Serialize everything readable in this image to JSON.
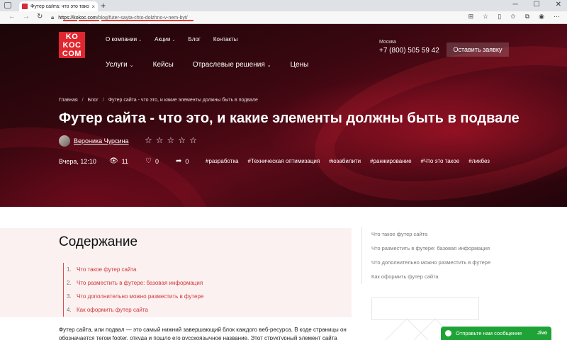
{
  "browser": {
    "tab_title": "Футер сайта: что это такое, ка",
    "tab_close": "×",
    "new_tab": "+",
    "url_host": "https://kokoc.com",
    "url_path": "/blog/futer-sayta-chto-dolzhno-v-nem-byt/"
  },
  "annotations": {
    "markers": [
      "1",
      "2",
      "3"
    ],
    "color": "#e53935"
  },
  "header": {
    "logo_lines": [
      "KO",
      "KOC",
      "COM"
    ],
    "top_nav": [
      {
        "label": "О компании",
        "has_dropdown": true
      },
      {
        "label": "Акции",
        "has_dropdown": true
      },
      {
        "label": "Блог",
        "has_dropdown": false
      },
      {
        "label": "Контакты",
        "has_dropdown": false
      }
    ],
    "main_nav": [
      {
        "label": "Услуги",
        "has_dropdown": true
      },
      {
        "label": "Кейсы",
        "has_dropdown": false
      },
      {
        "label": "Отраслевые решения",
        "has_dropdown": true
      },
      {
        "label": "Цены",
        "has_dropdown": false
      }
    ],
    "city": "Москва",
    "phone": "+7 (800) 505 59 42",
    "cta_label": "Оставить заявку",
    "accent_color": "#e0262f"
  },
  "breadcrumbs": [
    "Главная",
    "Блог",
    "Футер сайта - что это, и какие элементы должны быть в подвале"
  ],
  "article": {
    "title": "Футер сайта - что это, и какие элементы должны быть в подвале",
    "author": "Вероника Чурсина",
    "rating_stars": 5,
    "rating_value": 0,
    "date": "Вчера, 12:10",
    "views": "11",
    "likes": "0",
    "shares": "0",
    "tags": [
      "#разработка",
      "#Техническая оптимизация",
      "#юзабилити",
      "#ранжирование",
      "#Что это такое",
      "#ликбез"
    ],
    "intro_line1": "Футер сайта, или подвал — это самый нижний завершающий блок каждого веб-ресурса. В коде страницы он",
    "intro_line2": "обозначается тегом footer, откуда и пошло его русскоязычное название. Этот структурный элемент сайта"
  },
  "toc": {
    "title": "Содержание",
    "items": [
      {
        "num": "1.",
        "label": "Что такое футер сайта"
      },
      {
        "num": "2.",
        "label": "Что разместить в футере: базовая информация"
      },
      {
        "num": "3.",
        "label": "Что дополнительно можно разместить в футере"
      },
      {
        "num": "4.",
        "label": "Как оформить футер сайта"
      }
    ]
  },
  "side_toc": [
    "Что такое футер сайта",
    "Что разместить в футере: базовая информация",
    "Что дополнительно можно разместить в футере",
    "Как оформить футер сайта"
  ],
  "chat": {
    "label": "Отправьте нам сообщение",
    "brand": "Jivo",
    "color": "#1fa337"
  }
}
